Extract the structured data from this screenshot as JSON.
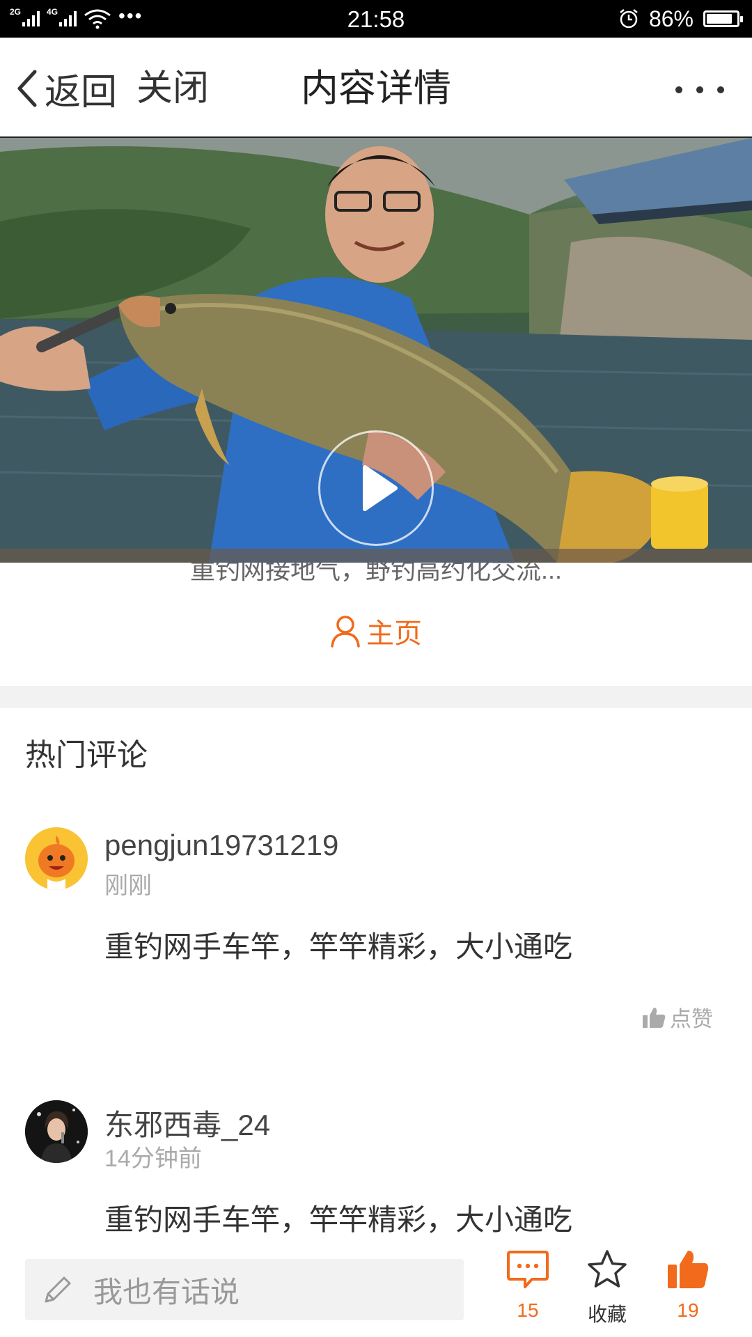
{
  "status_bar": {
    "network_1": "2G",
    "network_2": "4G",
    "time": "21:58",
    "battery": "86%",
    "battery_level": 0.86
  },
  "header": {
    "back_label": "返回",
    "close_label": "关闭",
    "title": "内容详情"
  },
  "video": {
    "description": "重钓网接地气，野钓高约化交流..."
  },
  "profile": {
    "homepage_label": "主页"
  },
  "comments_section": {
    "title": "热门评论",
    "comments": [
      {
        "user": "pengjun19731219",
        "time": "刚刚",
        "text": "重钓网手车竿，竿竿精彩，大小通吃",
        "like_label": "点赞"
      },
      {
        "user": "东邪西毒_24",
        "time": "14分钟前",
        "text": "重钓网手车竿，竿竿精彩，大小通吃"
      }
    ]
  },
  "bottom_bar": {
    "input_placeholder": "我也有话说",
    "comment_count": "15",
    "favorite_label": "收藏",
    "like_count": "19"
  },
  "colors": {
    "accent": "#f26a1b",
    "muted": "#aaaaaa",
    "divider": "#f2f2f2"
  }
}
